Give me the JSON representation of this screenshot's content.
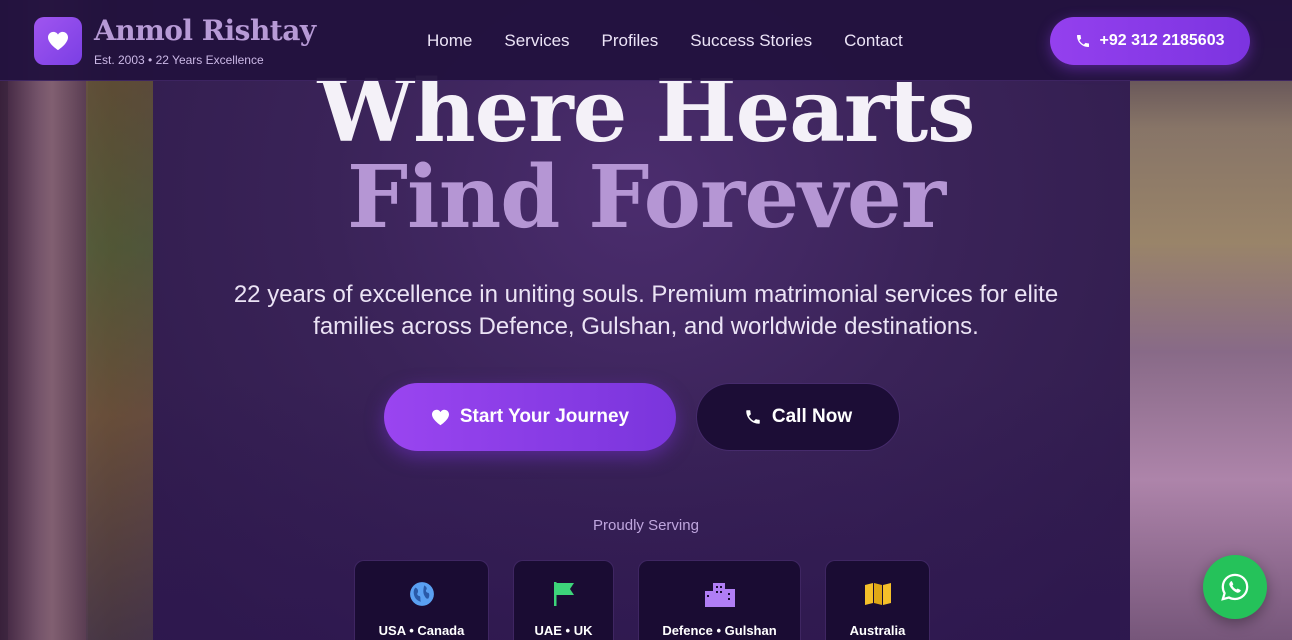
{
  "header": {
    "brand_name": "Anmol Rishtay",
    "brand_tagline": "Est. 2003 • 22 Years Excellence",
    "nav": [
      "Home",
      "Services",
      "Profiles",
      "Success Stories",
      "Contact"
    ],
    "phone_label": "+92 312 2185603"
  },
  "hero": {
    "title_line1": "Where Hearts",
    "title_line2": "Find Forever",
    "subtitle": "22 years of excellence in uniting souls. Premium matrimonial services for elite families across Defence, Gulshan, and worldwide destinations.",
    "primary_button": "Start Your Journey",
    "secondary_button": "Call Now"
  },
  "serving": {
    "label": "Proudly Serving",
    "locations": [
      {
        "label": "USA • Canada",
        "icon": "globe-icon"
      },
      {
        "label": "UAE • UK",
        "icon": "flag-icon"
      },
      {
        "label": "Defence • Gulshan",
        "icon": "building-icon"
      },
      {
        "label": "Australia",
        "icon": "map-icon"
      }
    ]
  },
  "colors": {
    "accent": "#8b3fea",
    "hero_title_secondary": "#b596d4",
    "whatsapp": "#25c25a"
  }
}
